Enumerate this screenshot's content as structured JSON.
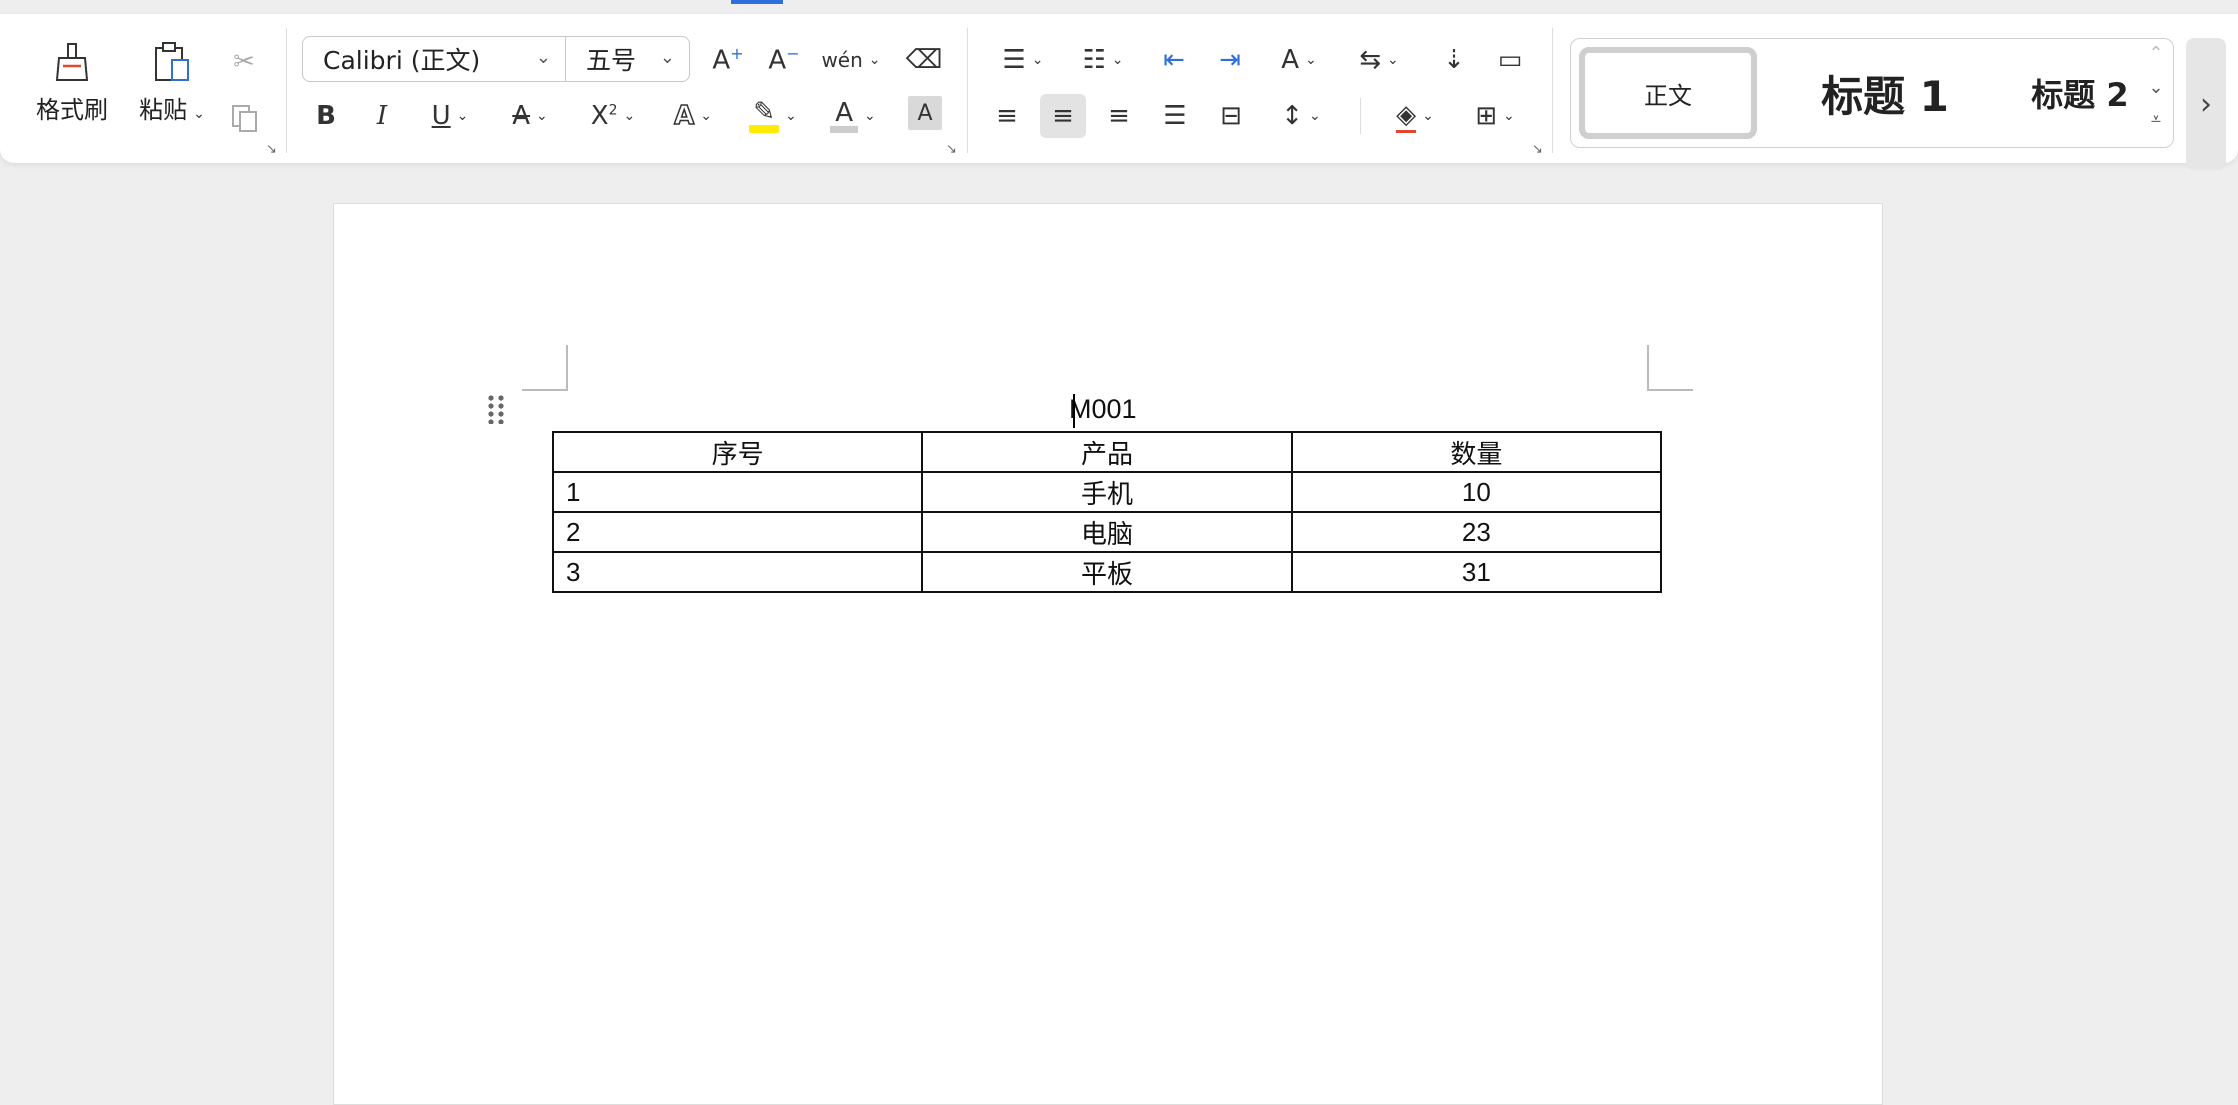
{
  "ribbon": {
    "clipboard": {
      "format_painter": "格式刷",
      "paste": "粘贴"
    },
    "font": {
      "name": "Calibri (正文)",
      "size": "五号",
      "phonetic_glyph": "wén"
    },
    "styles": {
      "normal": "正文",
      "heading1": "标题 1",
      "heading2": "标题 2"
    }
  },
  "document": {
    "title": "M001",
    "table": {
      "headers": [
        "序号",
        "产品",
        "数量"
      ],
      "rows": [
        [
          "1",
          "手机",
          "10"
        ],
        [
          "2",
          "电脑",
          "23"
        ],
        [
          "3",
          "平板",
          "31"
        ]
      ]
    }
  },
  "colors": {
    "accent": "#2e6fdb",
    "highlight": "#ffeb00",
    "font_color_bar": "#cccccc"
  }
}
